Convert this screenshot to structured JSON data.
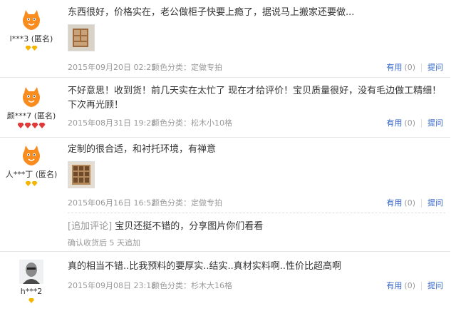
{
  "reviews": [
    {
      "user": "l***3 (匿名)",
      "text": "东西很好，价格实在，老公做柜子快要上瘾了，据说马上搬家还要做...",
      "date": "2015年09月20日 02:25",
      "sku_label": "颜色分类：",
      "sku_value": "定做专拍",
      "useful_label": "有用",
      "useful_count": "(0)",
      "ask_label": "提问"
    },
    {
      "user": "颜***7 (匿名)",
      "text": "不好意思！收到货！前几天实在太忙了 现在才给评价！宝贝质量很好，没有毛边做工精细！下次再光顾！",
      "date": "2015年08月31日 19:28",
      "sku_label": "颜色分类：",
      "sku_value": "松木小10格",
      "useful_label": "有用",
      "useful_count": "(0)",
      "ask_label": "提问"
    },
    {
      "user": "人***丁 (匿名)",
      "text": "定制的很合适，和衬托环境，有禅意",
      "date": "2015年06月16日 16:52",
      "sku_label": "颜色分类：",
      "sku_value": "定做专拍",
      "useful_label": "有用",
      "useful_count": "(0)",
      "ask_label": "提问",
      "append_tag": "[追加评论]",
      "append_text": "宝贝还挺不错的，分享图片你们看看",
      "append_meta": "确认收货后 5 天追加"
    },
    {
      "user": "h***2",
      "text": "真的相当不错..比我预料的要厚实..结实..真材实料啊..性价比超高啊",
      "date": "2015年09月08日 23:18",
      "sku_label": "颜色分类：",
      "sku_value": "杉木大16格",
      "useful_label": "有用",
      "useful_count": "(0)",
      "ask_label": "提问"
    }
  ],
  "colors": {
    "link": "#3366cc",
    "meta": "#999999",
    "gem_yellow": "#f6b500",
    "gem_red": "#e23a3a",
    "avatar_orange": "#f98c1f"
  },
  "icons": {
    "avatar_default": "orange-mascot-avatar",
    "avatar_photo": "user-photo-avatar",
    "rank_gem": "diamond-icon",
    "rank_heart": "red-diamond-icon"
  }
}
